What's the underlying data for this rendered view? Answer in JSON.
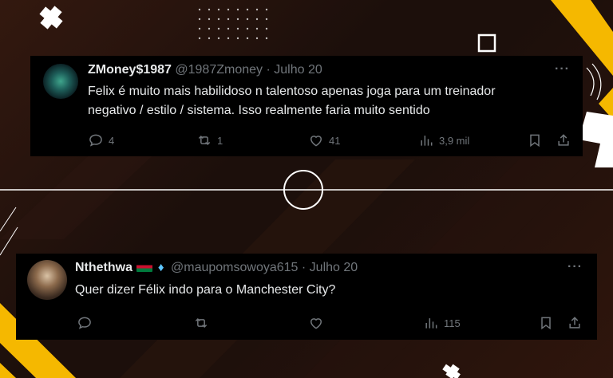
{
  "tweets": [
    {
      "display_name": "ZMoney$1987",
      "handle_date": "@1987Zmoney · Julho 20",
      "text_line1": "Felix é muito mais habilidoso n talentoso apenas joga para um treinador",
      "text_line2": "negativo / estilo / sistema. Isso realmente faria muito sentido",
      "replies": "4",
      "reposts": "1",
      "likes": "41",
      "views": "3,9 mil",
      "more": "···"
    },
    {
      "display_name": "Nthethwa",
      "handle_date": "@maupomsowoya615 · Julho 20",
      "text_line1": "Quer dizer Félix indo para o Manchester City?",
      "replies": "",
      "reposts": "",
      "likes": "",
      "views": "115",
      "more": "···"
    }
  ],
  "colors": {
    "background": "#1c0f0b",
    "card": "#000000",
    "text": "#e7e9ea",
    "muted": "#71767b",
    "accent_yellow": "#f5b800"
  }
}
